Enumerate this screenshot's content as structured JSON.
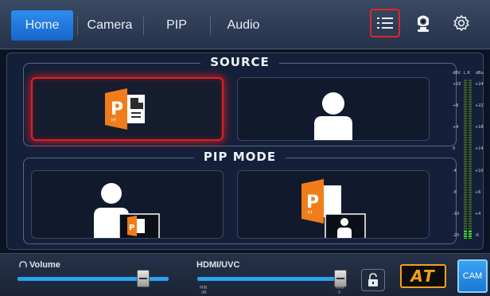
{
  "tabs": [
    {
      "label": "Home",
      "active": true
    },
    {
      "label": "Camera",
      "active": false
    },
    {
      "label": "PIP",
      "active": false
    },
    {
      "label": "Audio",
      "active": false
    }
  ],
  "toolbar_icons": [
    "list-icon",
    "camera-icon",
    "gear-icon"
  ],
  "source": {
    "title": "SOURCE",
    "tiles": [
      {
        "name": "ppt-source",
        "selected": true
      },
      {
        "name": "presenter-source",
        "selected": false
      }
    ]
  },
  "pip_mode": {
    "title": "PIP MODE",
    "tiles": [
      {
        "name": "presenter-with-ppt-inset"
      },
      {
        "name": "ppt-with-presenter-inset"
      }
    ]
  },
  "ppt_icon": {
    "big": "P",
    "small": "PT"
  },
  "vu_meter": {
    "header_left": "dBV",
    "header_channels": "L R",
    "header_right": "dBu",
    "left_scale": [
      "+10",
      "+8",
      "+4",
      "0",
      "-4",
      "-8",
      "-10",
      "-20"
    ],
    "right_scale": [
      "+24",
      "+22",
      "+18",
      "+14",
      "+10",
      "+6",
      "+4",
      "-6"
    ],
    "level_fraction": 0.05
  },
  "volume": {
    "label": "Volume",
    "icon": "headphones-icon",
    "value_fraction": 0.83
  },
  "hdmi_uvc": {
    "label": "HDMI/UVC",
    "min_label": "MIN",
    "min_sub": "dB",
    "max_label": "MAX",
    "max_sub": "0",
    "value_fraction": 0.97
  },
  "at_logo": "AT",
  "cam_button": "CAM",
  "colors": {
    "accent": "#1f7fe0",
    "selected_border": "#e01f24",
    "ppt_orange": "#f07d1a",
    "at_orange": "#f2a11a"
  }
}
